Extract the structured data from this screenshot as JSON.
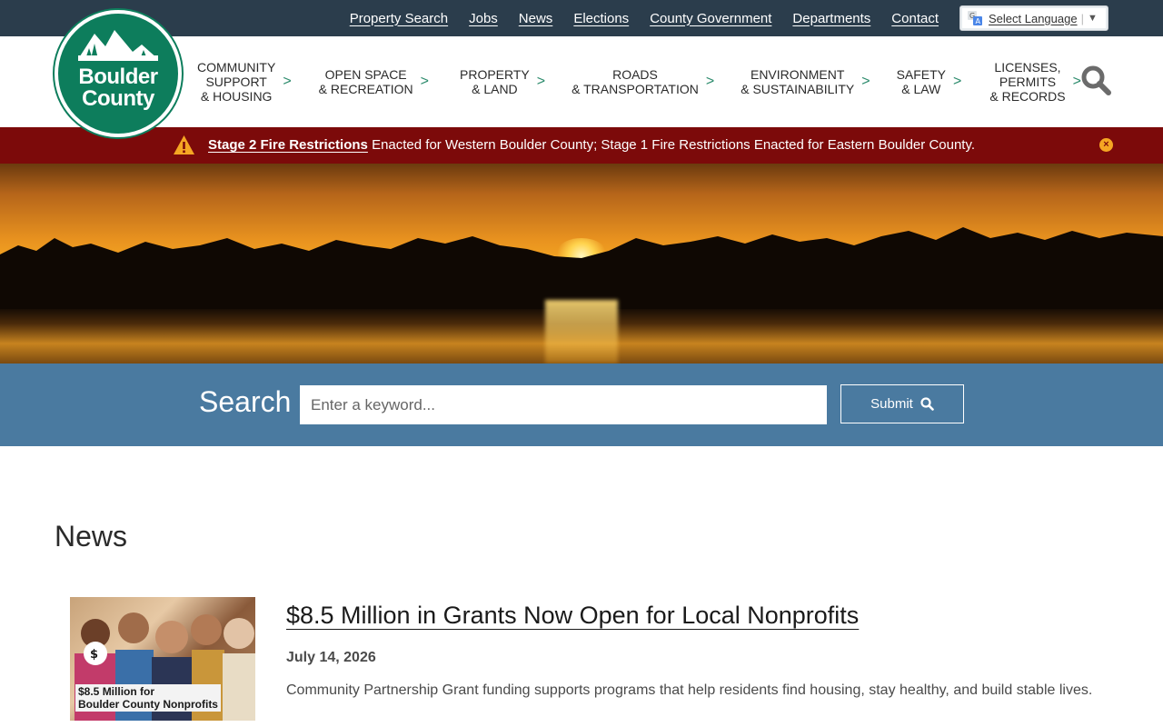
{
  "utility_nav": {
    "links": [
      "Property Search",
      "Jobs",
      "News",
      "Elections",
      "County Government",
      "Departments",
      "Contact"
    ],
    "language_select": "Select Language"
  },
  "logo": {
    "line1": "Boulder",
    "line2": "County"
  },
  "main_nav": {
    "items": [
      {
        "lines": [
          "COMMUNITY",
          "SUPPORT",
          "& HOUSING"
        ]
      },
      {
        "lines": [
          "OPEN SPACE",
          "& RECREATION"
        ]
      },
      {
        "lines": [
          "PROPERTY",
          "& LAND"
        ]
      },
      {
        "lines": [
          "ROADS",
          "& TRANSPORTATION"
        ]
      },
      {
        "lines": [
          "ENVIRONMENT",
          "& SUSTAINABILITY"
        ]
      },
      {
        "lines": [
          "SAFETY",
          "& LAW"
        ]
      },
      {
        "lines": [
          "LICENSES,",
          "PERMITS",
          "& RECORDS"
        ]
      }
    ],
    "chevron": ">"
  },
  "alert": {
    "link_text": "Stage 2 Fire Restrictions",
    "text": " Enacted for Western Boulder County; Stage 1 Fire Restrictions Enacted for Eastern Boulder County.",
    "close_glyph": "×"
  },
  "search": {
    "label": "Search",
    "placeholder": "Enter a keyword...",
    "submit_label": "Submit"
  },
  "news": {
    "heading": "News",
    "items": [
      {
        "title": "$8.5 Million in Grants Now Open for Local Nonprofits",
        "date": "July 14, 2026",
        "summary": "Community Partnership Grant funding supports programs that help residents find housing, stay healthy, and build stable lives.",
        "image_caption_line1": "$8.5 Million for",
        "image_caption_line2": "Boulder County Nonprofits"
      }
    ]
  },
  "colors": {
    "utility_bar": "#2b3d4c",
    "brand_green": "#0d7d5c",
    "alert_bar": "#7c0a0a",
    "search_band": "#4a7aa0",
    "alert_icon": "#f5a623"
  }
}
